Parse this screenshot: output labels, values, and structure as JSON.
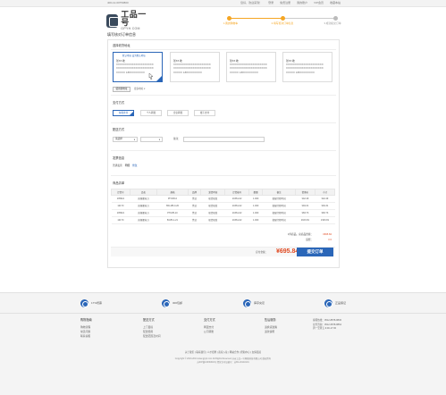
{
  "topbar": {
    "phone": "400-12-60750800",
    "links": [
      "您好，欢迎来到！",
      "登录",
      "免费注册",
      "我的账户",
      "VIP会员",
      "收藏本站"
    ]
  },
  "logo": {
    "cn": "工品一号",
    "en": "GPYH.COM"
  },
  "steps": [
    "1.我的购物车",
    "2.填写核对订单信息",
    "3.成功提交订单"
  ],
  "page_title": "填写核对订单信息",
  "address": {
    "title": "选择收货地址",
    "cards": [
      {
        "name": "张XX 收",
        "default_label": "默认地址  设为默认地址",
        "lines": [
          "XXXXXXXXXXXXXXXXXXXXX",
          "XXXXXXXXXXXXXXXXXXXXX",
          "XXXXX  188XXXXXXXX"
        ]
      },
      {
        "name": "张XX 收",
        "lines": [
          "XXXXXXXXXXXXXXXXXXXXX",
          "XXXXXXXXXXXXXXXXXXXXX",
          "XXXXX  188XXXXXXXX"
        ]
      },
      {
        "name": "张XX 收",
        "lines": [
          "XXXXXXXXXXXXXXXXXXXXX",
          "XXXXXXXXXXXXXXXXXXXXX",
          "XXXXX  188XXXXXXXX"
        ]
      },
      {
        "name": "张XX 收",
        "lines": [
          "XXXXXXXXXXXXXXXXXXXXX",
          "XXXXXXXXXXXXXXXXXXXXX",
          "XXXXX  188XXXXXXXX"
        ]
      }
    ],
    "new_button": "使用新地址",
    "more_link": "更多地址 ▾"
  },
  "payment": {
    "title": "支付方式",
    "options": [
      "在线支付",
      "个人转账",
      "企业转账",
      "线下支付"
    ]
  },
  "delivery": {
    "title": "配送方式",
    "select1": "请选择",
    "select2": "",
    "remark_label": "备注："
  },
  "invoice": {
    "title": "发票信息",
    "label": "普通发票",
    "value": "明细",
    "modify": "修改"
  },
  "goods": {
    "title": "商品清单",
    "headers": [
      "订货号",
      "品名",
      "规格",
      "品牌",
      "发货时间",
      "订货编号",
      "数量",
      "备注",
      "优惠价",
      "小计"
    ],
    "rows": [
      [
        "105621",
        "直角螺丝刀",
        "PH-M5-0",
        "世达",
        "现货现发",
        "10361-02",
        "1.000",
        "指配行程时间",
        "¥42.49",
        "¥42.49"
      ],
      [
        "12170",
        "直角螺丝刀",
        "SW-M5-0-20",
        "世达",
        "现货现发",
        "10361-02",
        "1.000",
        "指配行程时间",
        "¥94.31",
        "¥94.31"
      ],
      [
        "105621",
        "直角螺丝刀",
        "PH-M5-10",
        "世达",
        "现货现发",
        "10361-02",
        "1.000",
        "指配行程时间",
        "¥83.73",
        "¥83.73"
      ],
      [
        "12170",
        "直角螺丝刀",
        "B-M5-1-21",
        "世达",
        "现货现发",
        "10361-02",
        "1.000",
        "指配行程时间",
        "¥103.81",
        "¥103.81"
      ]
    ]
  },
  "summary": {
    "total_label": "1件商品，总商品金额：",
    "total_value": "¥695.84",
    "freight_label": "运费：",
    "freight_value": "¥ 0"
  },
  "pay_bar": {
    "label": "应付金额：",
    "amount": "¥695.84"
  },
  "submit_label": "提交订单",
  "guarantees": [
    "17%增票",
    "300包邮",
    "库存充足",
    "正品保证"
  ],
  "footer_cols": [
    {
      "title": "购物指南",
      "items": [
        "购物流程",
        "常见问题",
        "联系客服"
      ]
    },
    {
      "title": "配送方式",
      "items": [
        "上门自提",
        "配送费用",
        "配送范围及时间"
      ]
    },
    {
      "title": "支付方式",
      "items": [
        "网银支付",
        "公司转账"
      ]
    },
    {
      "title": "售后服务",
      "items": [
        "退换货政策",
        "退款说明"
      ]
    }
  ],
  "contact": [
    "客服热线：0512-8878-8830",
    "业务咨询：0512-6878-8862",
    "周一至周五 9:00-17:00"
  ],
  "footer_links": "关于我们 | 联系我们 | 人才招聘 | 商家入驻 | 网站合作 | 帮助中心 | 友情链接",
  "copyright": [
    "Copyright © 2013-2014 www.gpyh.com All Rights Reserved 苏州工品一号网络科技有限公司 版权所有",
    "苏ICP备13036318号  经营许可证编号：苏B1-20140101"
  ]
}
